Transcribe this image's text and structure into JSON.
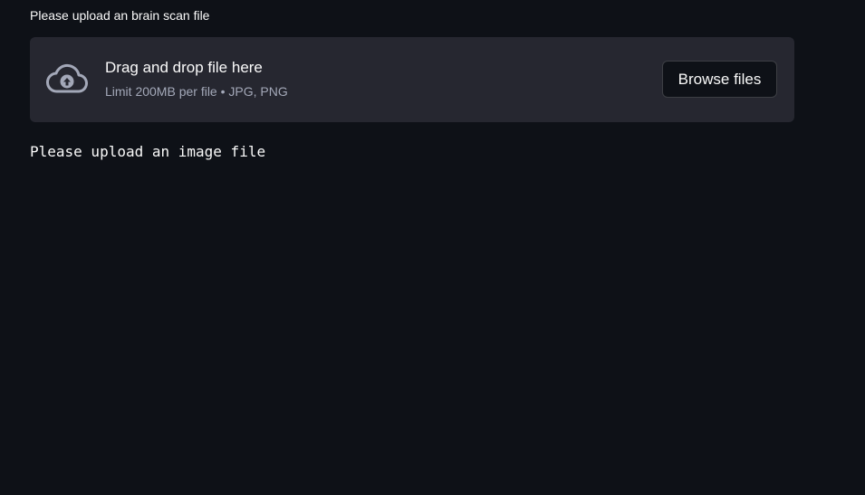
{
  "uploader": {
    "label": "Please upload an brain scan file",
    "dropzone_title": "Drag and drop file here",
    "dropzone_subtitle": "Limit 200MB per file • JPG, PNG",
    "browse_label": "Browse files",
    "icon": "cloud-upload-icon"
  },
  "status": {
    "message": "Please upload an image file"
  },
  "colors": {
    "background": "#0e1117",
    "dropzone": "#262730",
    "text": "#fafafa",
    "muted": "#a3a8b8"
  }
}
